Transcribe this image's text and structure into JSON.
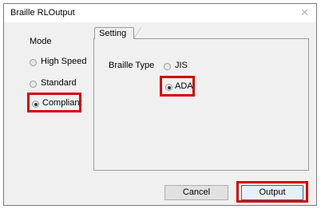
{
  "window": {
    "title": "Braille RLOutput",
    "close_glyph": "✕"
  },
  "mode": {
    "label": "Mode",
    "options": [
      "High Speed",
      "Standard",
      "Compliant"
    ],
    "selected": "Compliant"
  },
  "setting": {
    "tab_label": "Setting",
    "braille_type_label": "Braille Type",
    "options": [
      "JIS",
      "ADA"
    ],
    "selected": "ADA"
  },
  "buttons": {
    "cancel": "Cancel",
    "output": "Output"
  },
  "colors": {
    "highlight": "#d40000",
    "dialog_bg": "#f0f0f0"
  }
}
